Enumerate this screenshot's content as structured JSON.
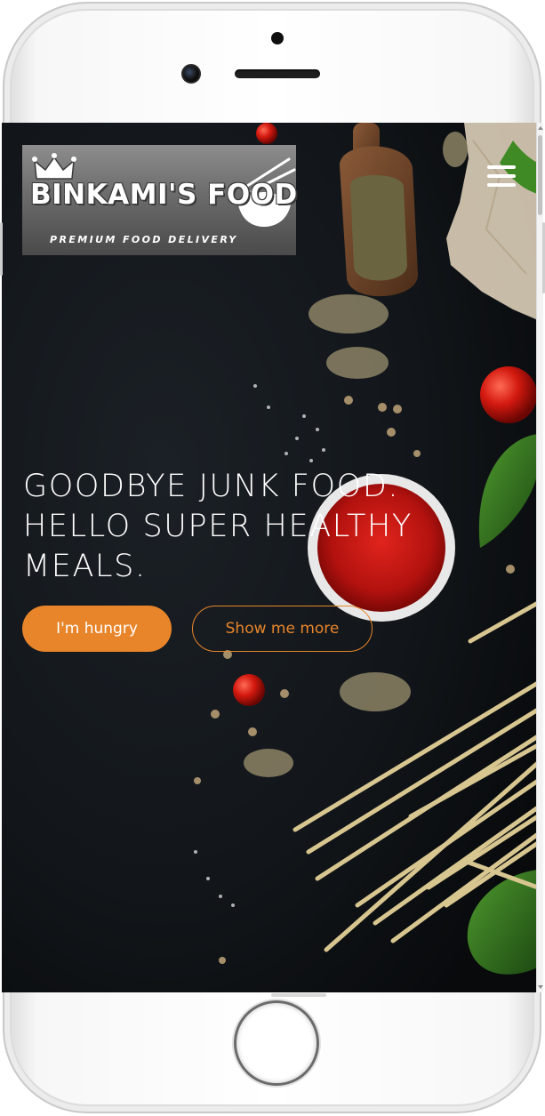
{
  "brand": {
    "name": "BINKAMI'S FOOD",
    "tagline": "PREMIUM FOOD DELIVERY",
    "logo_icon": "bowl-with-chopsticks-icon"
  },
  "nav": {
    "menu_icon": "hamburger-menu-icon"
  },
  "hero": {
    "headline": "GOODBYE JUNK FOOD. HELLO SUPER HEALTHY MEALS.",
    "primary_button": "I'm hungry",
    "secondary_button": "Show me more"
  },
  "colors": {
    "accent": "#e8852a",
    "hero_background": "#101418",
    "text": "#ffffff"
  }
}
